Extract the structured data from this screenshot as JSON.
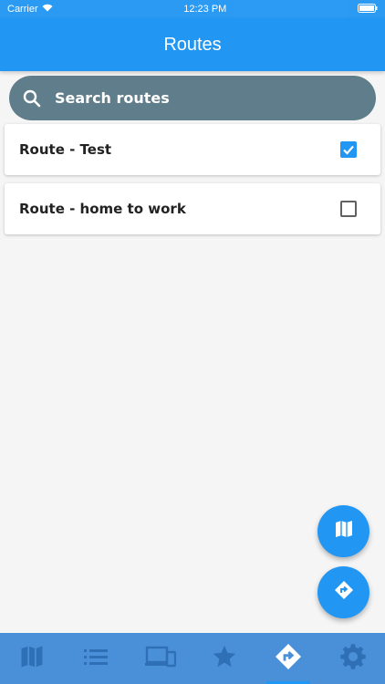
{
  "status_bar": {
    "carrier": "Carrier",
    "time": "12:23 PM"
  },
  "header": {
    "title": "Routes"
  },
  "search": {
    "placeholder": "Search routes",
    "icon": "search-icon"
  },
  "routes": [
    {
      "label": "Route - Test",
      "checked": true
    },
    {
      "label": "Route - home to work",
      "checked": false
    }
  ],
  "fabs": [
    {
      "icon": "map-icon"
    },
    {
      "icon": "directions-icon"
    }
  ],
  "bottom_nav": {
    "items": [
      {
        "icon": "map-icon",
        "active": false
      },
      {
        "icon": "list-icon",
        "active": false
      },
      {
        "icon": "devices-icon",
        "active": false
      },
      {
        "icon": "star-icon",
        "active": false
      },
      {
        "icon": "directions-icon",
        "active": true
      },
      {
        "icon": "gear-icon",
        "active": false
      }
    ]
  },
  "colors": {
    "primary": "#2196f3",
    "search_bg": "#607d8b",
    "bottom_nav_bg": "#4a90d9"
  }
}
